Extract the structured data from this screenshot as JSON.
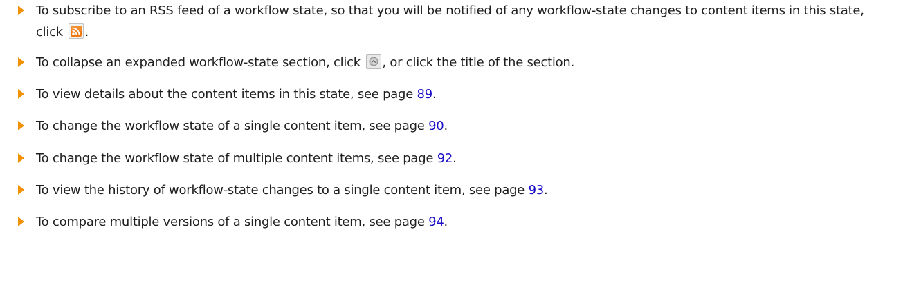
{
  "items": [
    {
      "text_before": "To subscribe to an RSS feed of a workflow state, so that you will be notified of any workflow-state changes to content items in this state, click",
      "icon": "rss-feed-icon",
      "text_after": "."
    },
    {
      "text_before": "To collapse an expanded workflow-state section, click",
      "icon": "collapse-section-icon",
      "text_after": ", or click the title of the section."
    },
    {
      "text": "To view details about the content items in this state, see page",
      "page": "89",
      "end": "."
    },
    {
      "text": "To change the workflow state of a single content item, see page",
      "page": "90",
      "end": "."
    },
    {
      "text": "To change the workflow state of multiple content items, see page",
      "page": "92",
      "end": "."
    },
    {
      "text": "To view the history of workflow-state changes to a single content item, see page",
      "page": "93",
      "end": "."
    },
    {
      "text": "To compare multiple versions of a single content item, see page",
      "page": "94",
      "end": "."
    }
  ],
  "colors": {
    "bullet": "#f29100",
    "link": "#1a0dc6",
    "rss": "#f07a12"
  }
}
